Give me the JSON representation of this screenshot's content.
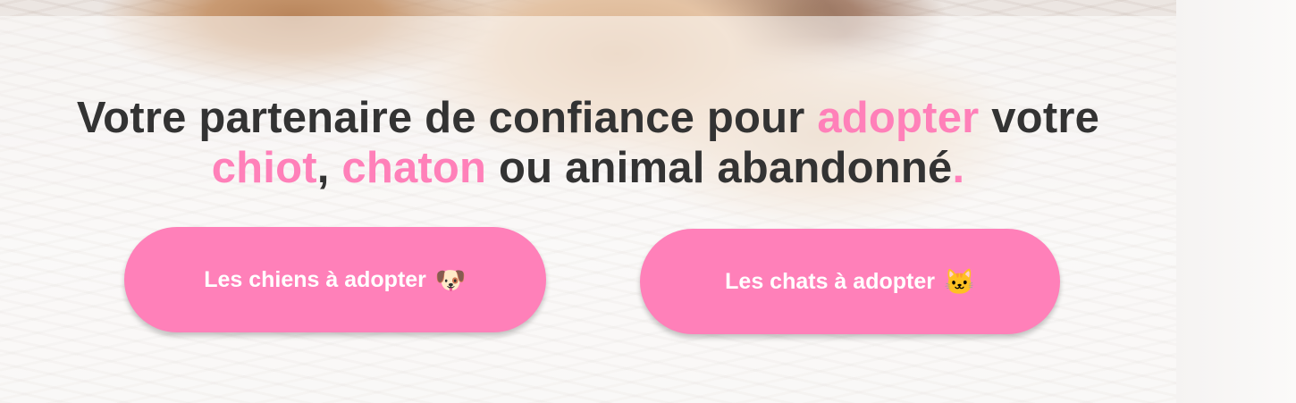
{
  "hero": {
    "headline": {
      "part1": "Votre partenaire de confiance pour ",
      "accent1": "adopter",
      "part2": " votre ",
      "accent2": "chiot",
      "part3": ", ",
      "accent3": "chaton",
      "part4": " ou animal abandonné",
      "accent4": "."
    },
    "buttons": [
      {
        "label": "Les chiens à adopter",
        "icon": "dog-face-icon",
        "emoji": "🐶"
      },
      {
        "label": "Les chats à adopter",
        "icon": "cat-face-icon",
        "emoji": "🐱"
      }
    ]
  },
  "colors": {
    "accent": "#ff80b9",
    "text": "#333333",
    "button_text": "#ffffff"
  }
}
